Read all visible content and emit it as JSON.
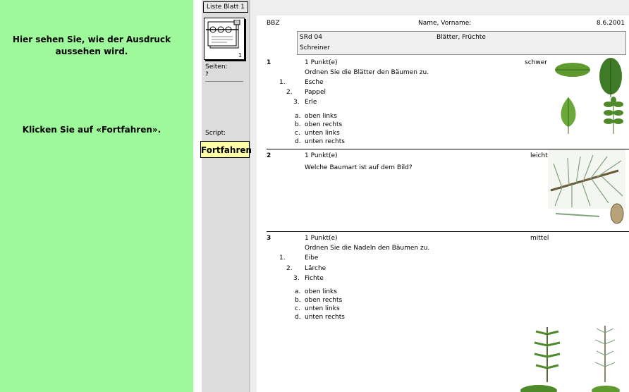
{
  "left_panel": {
    "message_1": "Hier sehen Sie, wie der Ausdruck aussehen wird.",
    "message_2": "Klicken Sie auf «Fortfahren»."
  },
  "sidebar": {
    "tab_label": "Liste Blatt 1",
    "page_number": "1",
    "pages_label": "Seiten:",
    "pages_value": "?",
    "script_label": "Script:",
    "continue_button": "Fortfahren"
  },
  "document": {
    "header": {
      "school": "BBZ",
      "name_label": "Name, Vorname:",
      "date": "8.6.2001",
      "class": "SRd 04",
      "topic": "Blätter, Früchte",
      "subject": "Schreiner"
    },
    "questions": [
      {
        "number": "1",
        "points": "1 Punkt(e)",
        "difficulty": "schwer",
        "prompt": "Ordnen Sie die Blätter den Bäumen zu.",
        "items": [
          {
            "n": "1.",
            "text": "Esche"
          },
          {
            "n": "2.",
            "text": "Pappel"
          },
          {
            "n": "3.",
            "text": "Erle"
          }
        ],
        "options": [
          {
            "k": "a.",
            "text": "oben links"
          },
          {
            "k": "b.",
            "text": "oben rechts"
          },
          {
            "k": "c.",
            "text": "unten links"
          },
          {
            "k": "d.",
            "text": "unten rechts"
          }
        ]
      },
      {
        "number": "2",
        "points": "1 Punkt(e)",
        "difficulty": "leicht",
        "prompt": "Welche Baumart ist auf dem Bild?"
      },
      {
        "number": "3",
        "points": "1 Punkt(e)",
        "difficulty": "mittel",
        "prompt": "Ordnen Sie die Nadeln den Bäumen zu.",
        "items": [
          {
            "n": "1.",
            "text": "Eibe"
          },
          {
            "n": "2.",
            "text": "Lärche"
          },
          {
            "n": "3.",
            "text": "Fichte"
          }
        ],
        "options": [
          {
            "k": "a.",
            "text": "oben links"
          },
          {
            "k": "b.",
            "text": "oben rechts"
          },
          {
            "k": "c.",
            "text": "unten links"
          },
          {
            "k": "d.",
            "text": "unten rechts"
          }
        ]
      }
    ]
  },
  "colors": {
    "left_panel_bg": "#9ef99a",
    "button_bg": "#ffffa8",
    "leaf_green": "#5e9a2e",
    "needle_green": "#7fa37a"
  }
}
